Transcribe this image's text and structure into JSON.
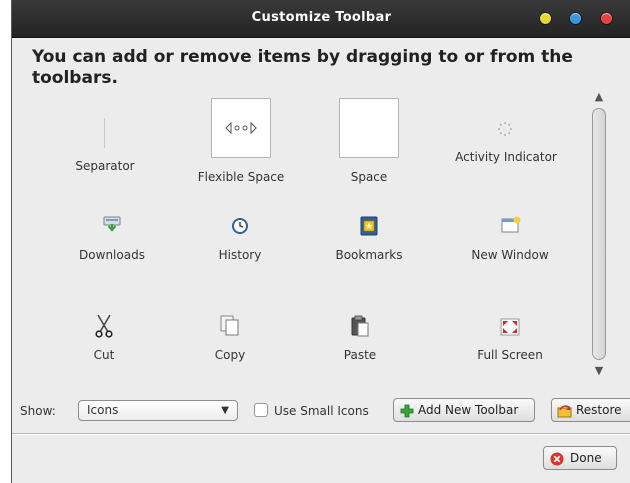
{
  "window": {
    "title": "Customize Toolbar"
  },
  "instructions": "You can add or remove items by dragging to or from the toolbars.",
  "items": [
    {
      "label": "Separator",
      "icon": "separator-icon"
    },
    {
      "label": "Flexible Space",
      "icon": "flexible-space-icon"
    },
    {
      "label": "Space",
      "icon": "space-icon"
    },
    {
      "label": "Activity Indicator",
      "icon": "activity-indicator-icon"
    },
    {
      "label": "Downloads",
      "icon": "downloads-icon"
    },
    {
      "label": "History",
      "icon": "history-icon"
    },
    {
      "label": "Bookmarks",
      "icon": "bookmarks-icon"
    },
    {
      "label": "New Window",
      "icon": "new-window-icon"
    },
    {
      "label": "Cut",
      "icon": "scissors-icon"
    },
    {
      "label": "Copy",
      "icon": "copy-icon"
    },
    {
      "label": "Paste",
      "icon": "paste-icon"
    },
    {
      "label": "Full Screen",
      "icon": "full-screen-icon"
    }
  ],
  "show": {
    "label": "Show:",
    "selected": "Icons"
  },
  "small_icons": {
    "label": "Use Small Icons",
    "checked": false
  },
  "buttons": {
    "add_toolbar": "Add New Toolbar",
    "restore": "Restore",
    "done": "Done"
  },
  "colors": {
    "titlebar": "#2b2b2b",
    "close": "#e8423c",
    "maximize": "#3a96dd",
    "minimize": "#e7d92b",
    "add_green": "#3aa33a"
  }
}
